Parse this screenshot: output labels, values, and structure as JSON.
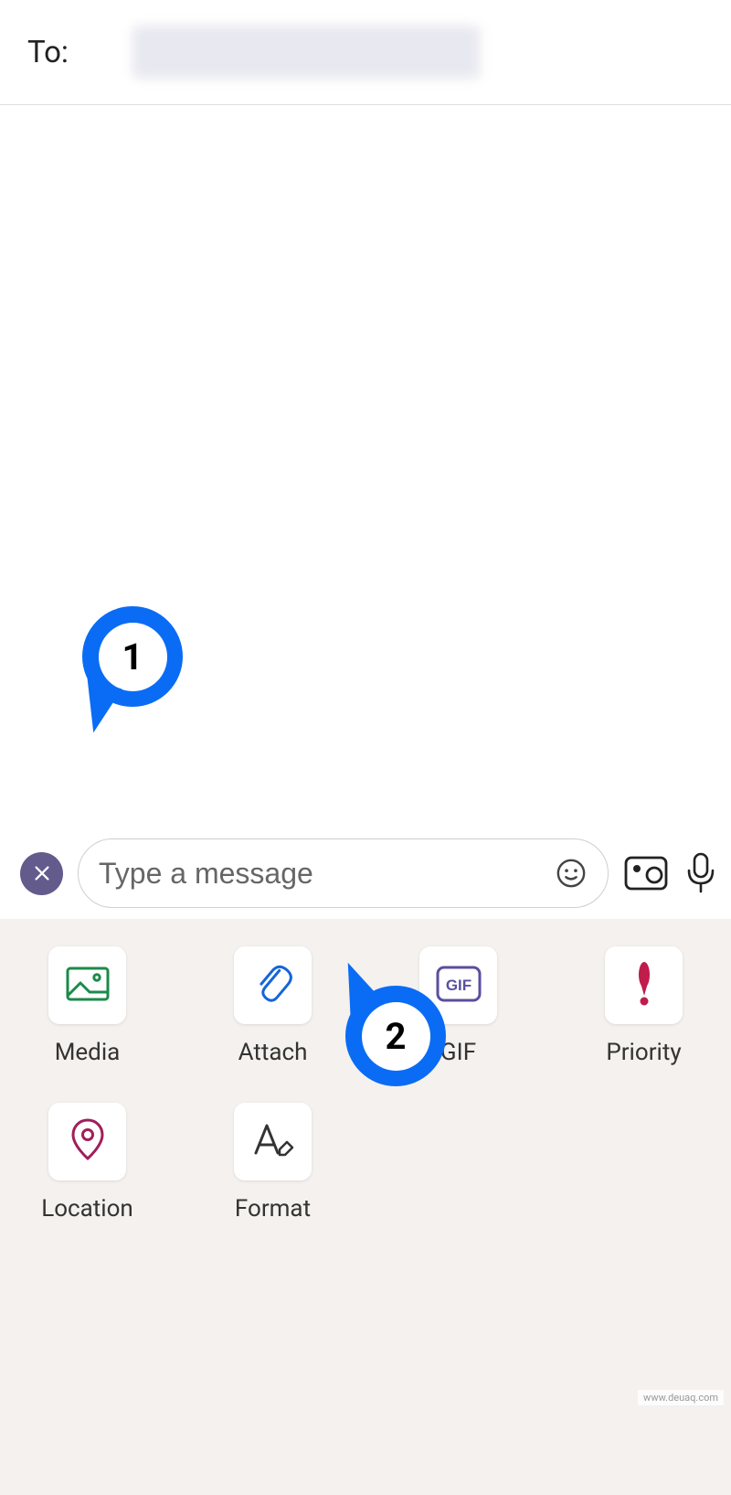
{
  "header": {
    "to_label": "To:"
  },
  "input": {
    "placeholder": "Type a message"
  },
  "callouts": {
    "one": "1",
    "two": "2"
  },
  "actions": [
    {
      "id": "media",
      "label": "Media",
      "icon": "media",
      "color": "#1b8a4a"
    },
    {
      "id": "attach",
      "label": "Attach",
      "icon": "attach",
      "color": "#1565d8"
    },
    {
      "id": "gif",
      "label": "GIF",
      "icon": "gif",
      "color": "#5a4f9f"
    },
    {
      "id": "priority",
      "label": "Priority",
      "icon": "priority",
      "color": "#c01c4c"
    },
    {
      "id": "location",
      "label": "Location",
      "icon": "location",
      "color": "#a01e5b"
    },
    {
      "id": "format",
      "label": "Format",
      "icon": "format",
      "color": "#333333"
    }
  ],
  "watermark": "www.deuaq.com"
}
